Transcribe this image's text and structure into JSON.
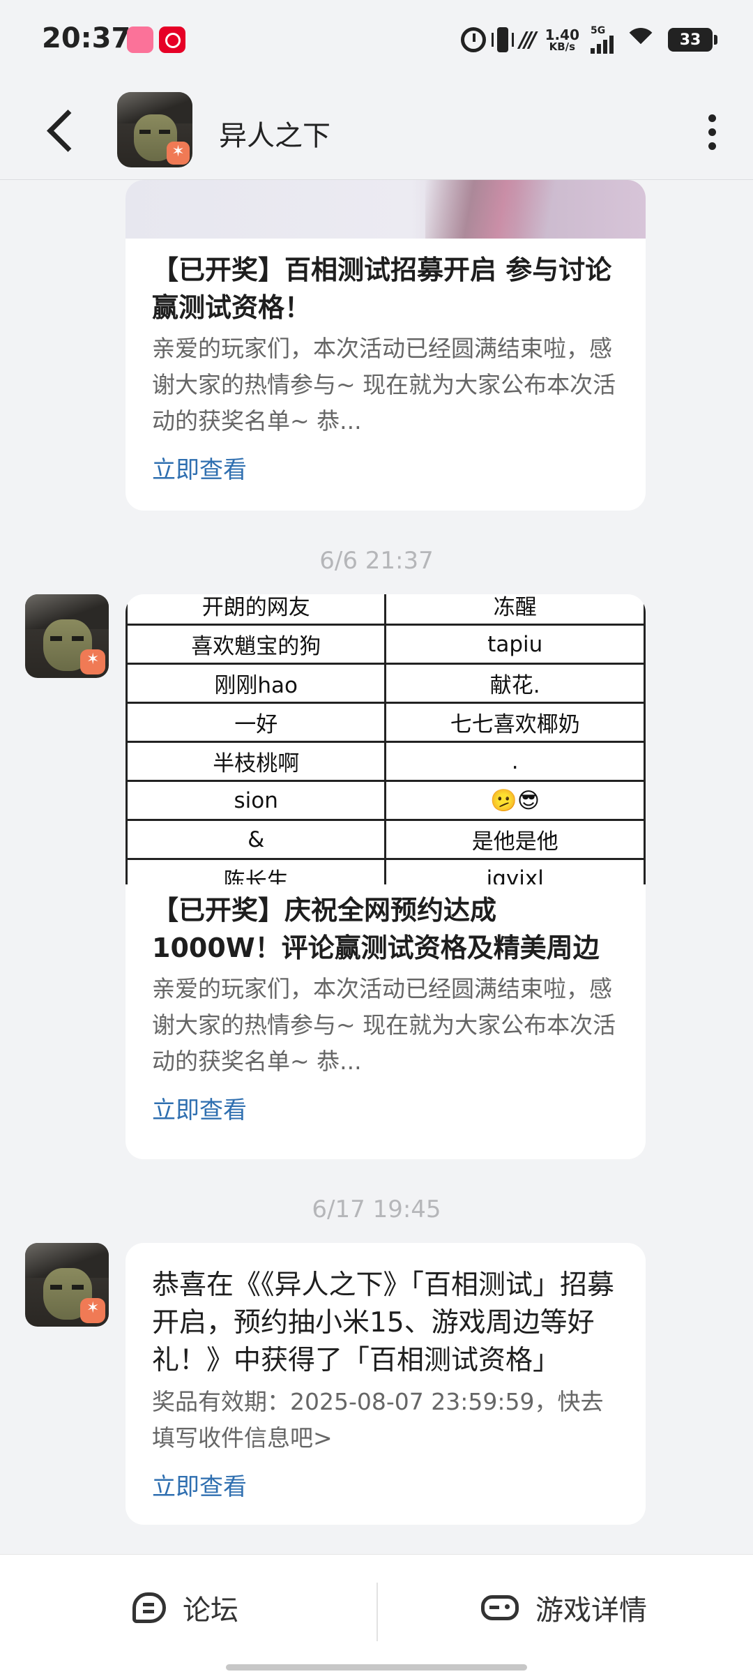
{
  "status_bar": {
    "time": "20:37",
    "apps": [
      "bilibili-icon",
      "netease-music-icon"
    ],
    "network_speed_value": "1.40",
    "network_speed_unit": "KB/s",
    "network_type": "5G",
    "battery": "33"
  },
  "header": {
    "title": "异人之下",
    "icons": [
      "back-icon",
      "game-avatar",
      "more-icon"
    ]
  },
  "messages": [
    {
      "title": "【已开奖】百相测试招募开启 参与讨论赢测试资格！",
      "description": "亲爱的玩家们，本次活动已经圆满结束啦，感谢大家的热情参与~ 现在就为大家公布本次活动的获奖名单~ 恭...",
      "link": "立即查看"
    },
    {
      "timestamp": "6/6  21:37",
      "table_rows": [
        [
          "开朗的网友",
          "冻醒"
        ],
        [
          "喜欢魈宝的狗",
          "tapiu"
        ],
        [
          "刚刚hao",
          "献花."
        ],
        [
          "一好",
          "七七喜欢椰奶"
        ],
        [
          "半枝桃啊",
          "."
        ],
        [
          "sion",
          "🫤😎"
        ],
        [
          "&",
          "是他是他"
        ],
        [
          "陈长生",
          "jqyixl"
        ]
      ],
      "title": "【已开奖】庆祝全网预约达成1000W！评论赢测试资格及精美周边",
      "description": "亲爱的玩家们，本次活动已经圆满结束啦，感谢大家的热情参与~ 现在就为大家公布本次活动的获奖名单~ 恭...",
      "link": "立即查看"
    },
    {
      "timestamp": "6/17  19:45",
      "title": "恭喜在《《异人之下》「百相测试」招募开启，预约抽小米15、游戏周边等好礼！》中获得了「百相测试资格」",
      "description": "奖品有效期：2025-08-07 23:59:59，快去填写收件信息吧>",
      "link": "立即查看"
    }
  ],
  "bottom_bar": {
    "forum_label": "论坛",
    "game_details_label": "游戏详情",
    "icons": [
      "forum-icon",
      "gamepad-icon"
    ]
  },
  "colors": {
    "background": "#f2f3f5",
    "card": "#ffffff",
    "link": "#2f6fb0",
    "timestamp": "#b5b6b9"
  }
}
